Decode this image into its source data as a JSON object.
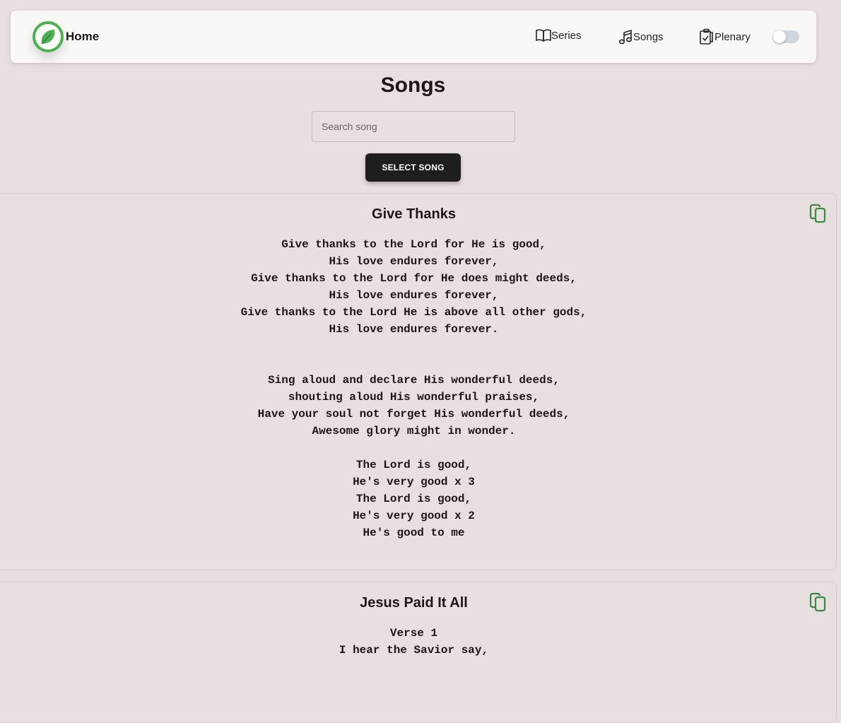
{
  "navbar": {
    "brand_label": "Home",
    "logo_icon": "leaf-icon",
    "items": [
      {
        "label": "Series",
        "icon": "book-open-icon"
      },
      {
        "label": "Songs",
        "icon": "music-note-icon"
      },
      {
        "label": "Plenary",
        "icon": "clipboard-check-icon"
      }
    ],
    "theme_toggle": {
      "state": "off"
    }
  },
  "page": {
    "title": "Songs"
  },
  "search": {
    "placeholder": "Search song",
    "value": ""
  },
  "select_button": {
    "label": "SELECT SONG"
  },
  "colors": {
    "accent_green": "#4caf50",
    "button_dark": "#1e1e1e",
    "background": "#e8dfe0"
  },
  "songs": [
    {
      "title": "Give Thanks",
      "copy_icon": "copy-icon",
      "lyrics": "Give thanks to the Lord for He is good,\nHis love endures forever,\nGive thanks to the Lord for He does might deeds,\nHis love endures forever,\nGive thanks to the Lord He is above all other gods,\nHis love endures forever.\n\n\nSing aloud and declare His wonderful deeds,\nshouting aloud His wonderful praises,\nHave your soul not forget His wonderful deeds,\nAwesome glory might in wonder.\n\nThe Lord is good,\nHe's very good x 3\nThe Lord is good,\nHe's very good x 2\nHe's good to me"
    },
    {
      "title": "Jesus Paid It All",
      "copy_icon": "copy-icon",
      "lyrics": "Verse 1\nI hear the Savior say,"
    }
  ]
}
